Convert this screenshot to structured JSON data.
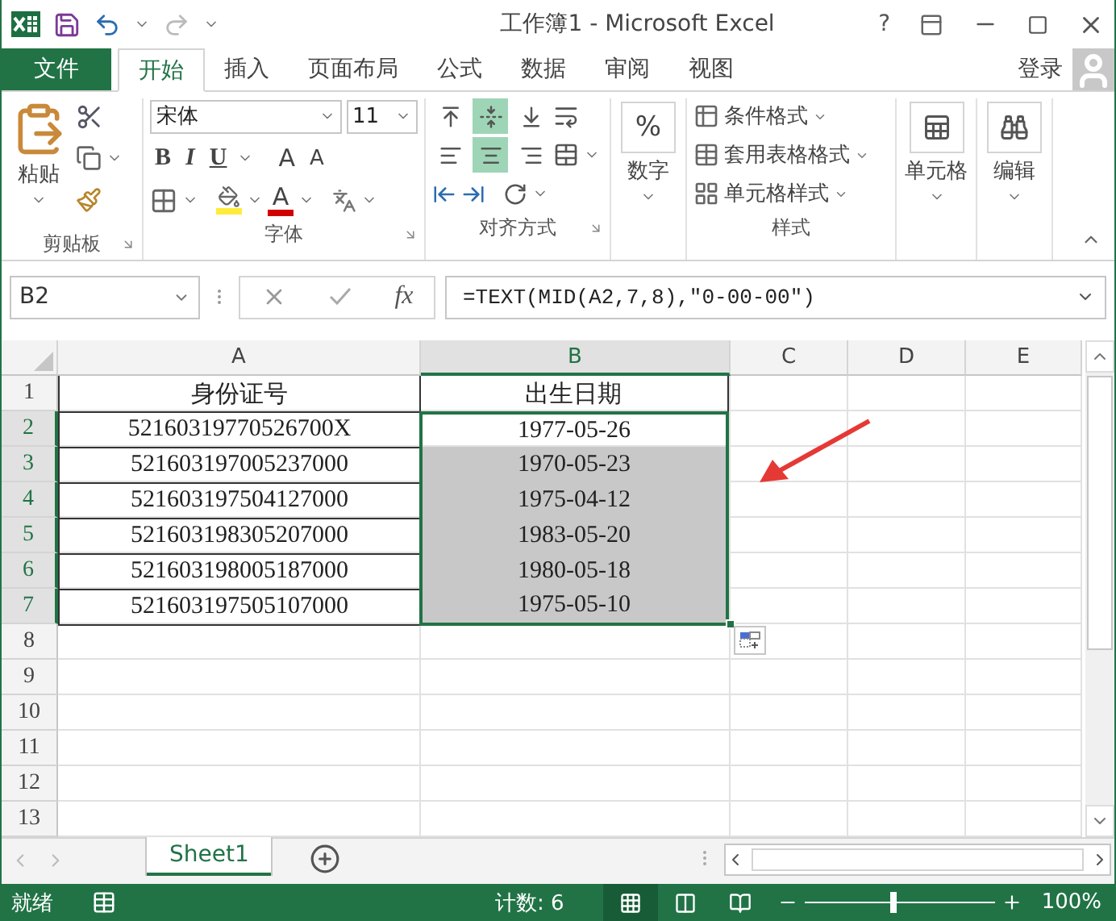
{
  "window": {
    "title": "工作簿1 - Microsoft Excel",
    "help": "?"
  },
  "tabs": [
    {
      "label": "文件",
      "kind": "file",
      "selected": false
    },
    {
      "label": "开始",
      "kind": "tab",
      "selected": true
    },
    {
      "label": "插入",
      "kind": "tab",
      "selected": false
    },
    {
      "label": "页面布局",
      "kind": "tab",
      "selected": false
    },
    {
      "label": "公式",
      "kind": "tab",
      "selected": false
    },
    {
      "label": "数据",
      "kind": "tab",
      "selected": false
    },
    {
      "label": "审阅",
      "kind": "tab",
      "selected": false
    },
    {
      "label": "视图",
      "kind": "tab",
      "selected": false
    }
  ],
  "login": "登录",
  "ribbon": {
    "clipboard": {
      "label": "剪贴板",
      "paste": "粘贴"
    },
    "font": {
      "label": "字体",
      "font_name": "宋体",
      "font_size": "11",
      "format_buttons": [
        "B",
        "I",
        "U"
      ],
      "size_buttons": [
        "A",
        "A"
      ],
      "color_letter": "A"
    },
    "alignment": {
      "label": "对齐方式",
      "vertical": [
        {
          "selected": false
        },
        {
          "selected": true
        },
        {
          "selected": false
        }
      ],
      "horizontal": [
        {
          "selected": false
        },
        {
          "selected": true
        },
        {
          "selected": false
        }
      ]
    },
    "number": {
      "symbol": "%",
      "label": "数字"
    },
    "styles": {
      "label": "样式",
      "items": [
        "条件格式",
        "套用表格格式",
        "单元格样式"
      ]
    },
    "cells": {
      "label": "单元格"
    },
    "editing": {
      "label": "编辑"
    }
  },
  "formula_bar": {
    "name_box": "B2",
    "fx": "fx",
    "formula": "=TEXT(MID(A2,7,8),\"0-00-00\")"
  },
  "grid": {
    "columns": [
      {
        "label": "A",
        "selected": false
      },
      {
        "label": "B",
        "selected": true
      },
      {
        "label": "C",
        "selected": false
      },
      {
        "label": "D",
        "selected": false
      },
      {
        "label": "E",
        "selected": false
      }
    ],
    "rows": [
      {
        "header": "1",
        "selected": false,
        "cells": [
          {
            "text": "身份证号",
            "selected": false,
            "shaded": false
          },
          {
            "text": "出生日期",
            "selected": false,
            "shaded": false
          }
        ]
      },
      {
        "header": "2",
        "selected": true,
        "cells": [
          {
            "text": "52160319770526700X",
            "selected": false,
            "shaded": false
          },
          {
            "text": "1977-05-26",
            "selected": true,
            "shaded": false
          }
        ]
      },
      {
        "header": "3",
        "selected": true,
        "cells": [
          {
            "text": "521603197005237000",
            "selected": false,
            "shaded": false
          },
          {
            "text": "1970-05-23",
            "selected": true,
            "shaded": true
          }
        ]
      },
      {
        "header": "4",
        "selected": true,
        "cells": [
          {
            "text": "521603197504127000",
            "selected": false,
            "shaded": false
          },
          {
            "text": "1975-04-12",
            "selected": true,
            "shaded": true
          }
        ]
      },
      {
        "header": "5",
        "selected": true,
        "cells": [
          {
            "text": "521603198305207000",
            "selected": false,
            "shaded": false
          },
          {
            "text": "1983-05-20",
            "selected": true,
            "shaded": true
          }
        ]
      },
      {
        "header": "6",
        "selected": true,
        "cells": [
          {
            "text": "521603198005187000",
            "selected": false,
            "shaded": false
          },
          {
            "text": "1980-05-18",
            "selected": true,
            "shaded": true
          }
        ]
      },
      {
        "header": "7",
        "selected": true,
        "cells": [
          {
            "text": "521603197505107000",
            "selected": false,
            "shaded": false
          },
          {
            "text": "1975-05-10",
            "selected": true,
            "shaded": true
          }
        ]
      },
      {
        "header": "8",
        "selected": false
      },
      {
        "header": "9",
        "selected": false
      },
      {
        "header": "10",
        "selected": false
      },
      {
        "header": "11",
        "selected": false
      },
      {
        "header": "12",
        "selected": false
      },
      {
        "header": "13",
        "selected": false
      }
    ]
  },
  "sheets": [
    {
      "label": "Sheet1",
      "selected": true
    }
  ],
  "status_bar": {
    "ready": "就绪",
    "count": "计数: 6",
    "views": [
      {
        "selected": true
      },
      {
        "selected": false
      },
      {
        "selected": false
      }
    ],
    "zoom": {
      "level": 0.47,
      "reading": "100%"
    }
  }
}
